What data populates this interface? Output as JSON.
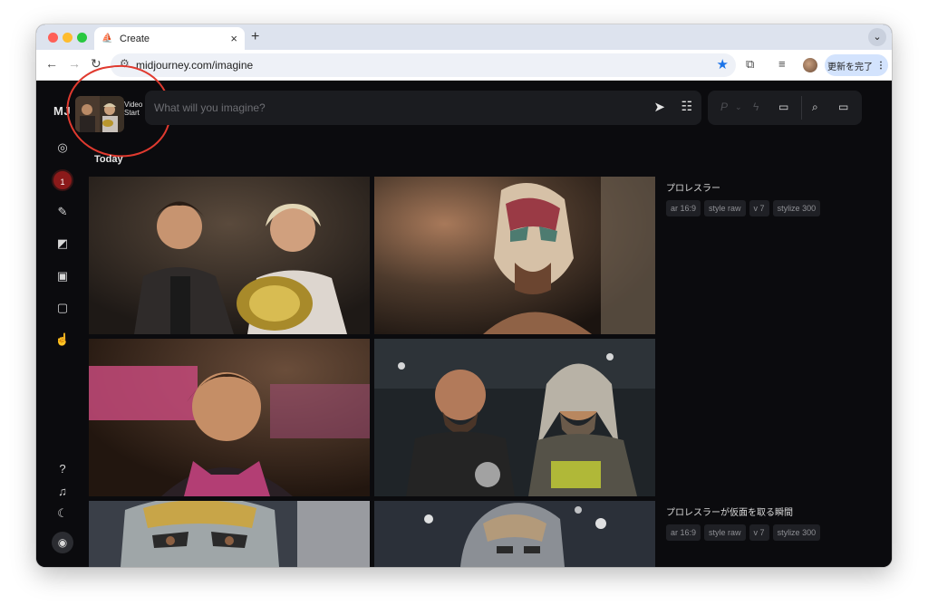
{
  "browser": {
    "tab_title": "Create",
    "url": "midjourney.com/imagine",
    "update_button_label": "更新を完了",
    "new_tab_glyph": "+",
    "close_glyph": "×"
  },
  "app": {
    "logo": "MJ",
    "video_label_line1": "Video",
    "video_label_line2": "Start",
    "prompt_placeholder": "What will you imagine?",
    "notification_count": "1",
    "section_heading": "Today"
  },
  "jobs": [
    {
      "prompt": "プロレスラー",
      "params": [
        "ar 16:9",
        "style raw",
        "v 7",
        "stylize 300"
      ]
    },
    {
      "prompt": "プロレスラーが仮面を取る瞬間",
      "params": [
        "ar 16:9",
        "style raw",
        "v 7",
        "stylize 300"
      ]
    }
  ],
  "colors": {
    "background": "#0b0b0e",
    "panel": "#1b1c20",
    "annotation_circle": "#e03a2f",
    "notification_badge": "#8b1a1a",
    "bookmark_star": "#1a73e8"
  },
  "icons": [
    "favicon-icon",
    "back-icon",
    "forward-icon",
    "reload-icon",
    "site-settings-icon",
    "bookmark-star-icon",
    "extensions-icon",
    "reading-list-icon",
    "send-icon",
    "sliders-icon",
    "personalize-icon",
    "speed-icon",
    "chat-icon",
    "search-icon",
    "folder-icon",
    "explore-icon",
    "create-icon",
    "edit-icon",
    "personalize-icon",
    "gallery-icon",
    "messages-icon",
    "likes-icon",
    "help-icon",
    "bell-icon",
    "moon-icon",
    "user-icon"
  ]
}
